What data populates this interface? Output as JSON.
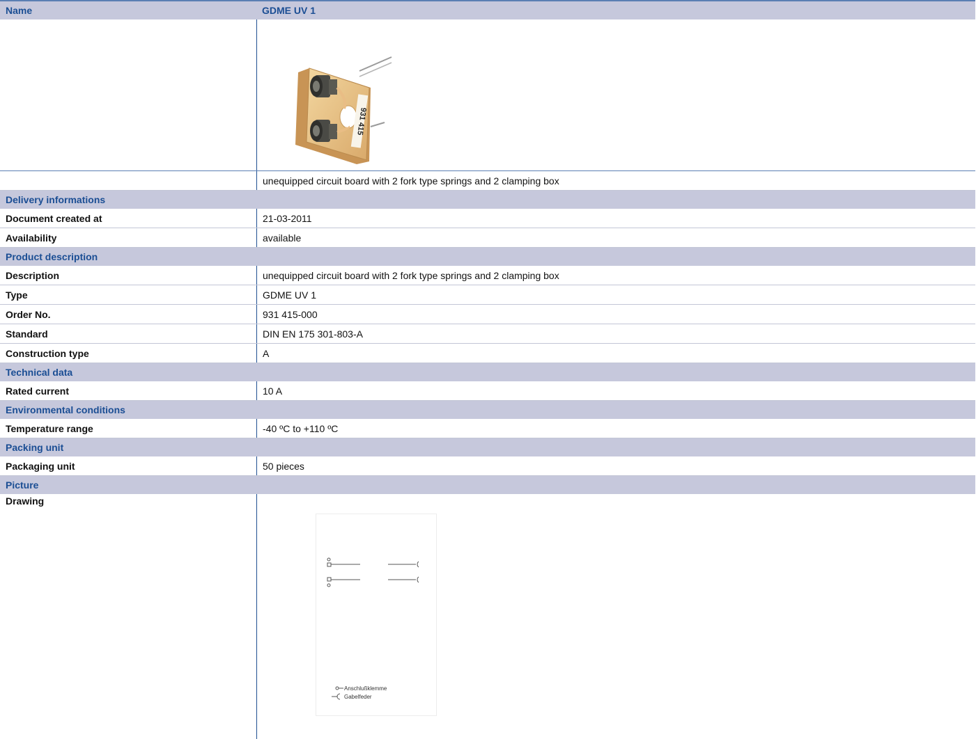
{
  "header": {
    "name_label": "Name",
    "name_value": "GDME UV 1"
  },
  "product_image": {
    "label_text": "931 415"
  },
  "caption": "unequipped circuit board with 2 fork type springs and 2 clamping box",
  "delivery": {
    "title": "Delivery informations",
    "rows": [
      {
        "label": "Document created at",
        "value": "21-03-2011"
      },
      {
        "label": "Availability",
        "value": "available"
      }
    ]
  },
  "product": {
    "title": "Product description",
    "rows": [
      {
        "label": "Description",
        "value": "unequipped circuit board with 2 fork type springs and 2 clamping box"
      },
      {
        "label": "Type",
        "value": "GDME UV 1"
      },
      {
        "label": "Order No.",
        "value": "931 415-000"
      },
      {
        "label": "Standard",
        "value": "DIN EN 175 301-803-A"
      },
      {
        "label": "Construction type",
        "value": "A"
      }
    ]
  },
  "technical": {
    "title": "Technical data",
    "rows": [
      {
        "label": "Rated current",
        "value": "10 A"
      }
    ]
  },
  "environment": {
    "title": "Environmental conditions",
    "rows": [
      {
        "label": "Temperature range",
        "value": "-40 ºC to +110 ºC"
      }
    ]
  },
  "packing": {
    "title": "Packing unit",
    "rows": [
      {
        "label": "Packaging unit",
        "value": "50 pieces"
      }
    ]
  },
  "picture": {
    "title": "Picture",
    "drawing_label": "Drawing",
    "legend": [
      "Anschlußklemme",
      "Gabelfeder"
    ]
  }
}
